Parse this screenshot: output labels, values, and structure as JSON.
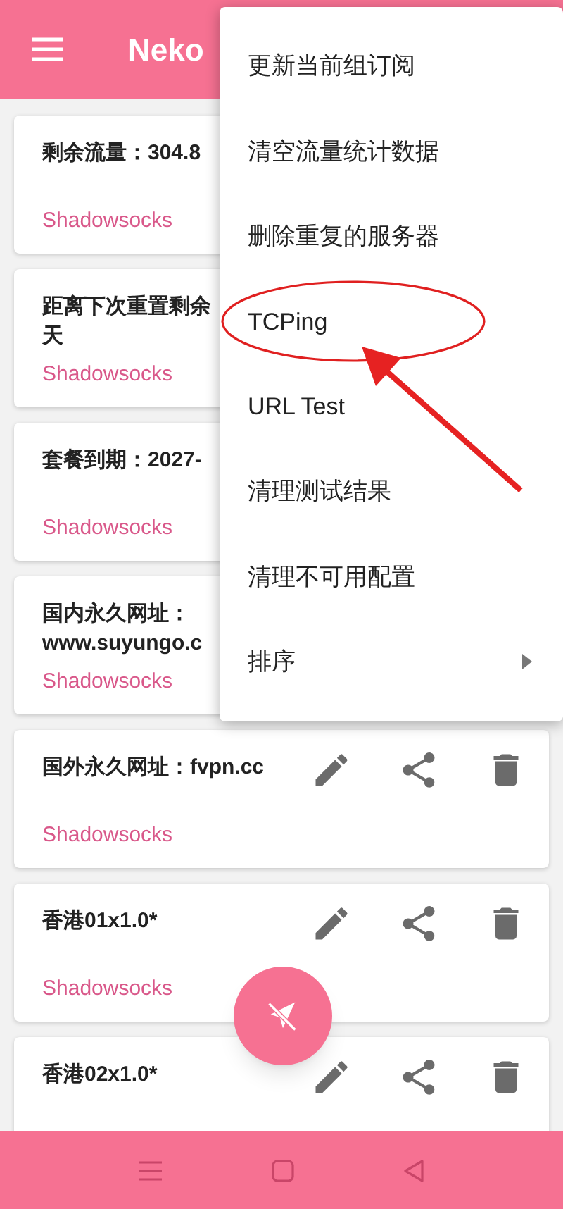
{
  "app_bar": {
    "title": "Neko"
  },
  "cards": [
    {
      "lines": [
        "剩余流量：304.8"
      ],
      "protocol": "Shadowsocks"
    },
    {
      "lines": [
        "距离下次重置剩余",
        "天"
      ],
      "protocol": "Shadowsocks"
    },
    {
      "lines": [
        "套餐到期：2027-"
      ],
      "protocol": "Shadowsocks"
    },
    {
      "lines": [
        "国内永久网址：",
        "www.suyungo.c"
      ],
      "protocol": "Shadowsocks"
    },
    {
      "lines": [
        "国外永久网址：fvpn.cc"
      ],
      "protocol": "Shadowsocks",
      "actions_visible": true
    },
    {
      "lines": [
        "香港01x1.0*"
      ],
      "protocol": "Shadowsocks",
      "actions_visible": true
    },
    {
      "lines": [
        "香港02x1.0*"
      ],
      "actions_visible": true
    }
  ],
  "menu": [
    {
      "label": "更新当前组订阅",
      "kind": "item",
      "annotated": false
    },
    {
      "label": "清空流量统计数据",
      "kind": "item",
      "annotated": false
    },
    {
      "label": "删除重复的服务器",
      "kind": "item",
      "annotated": false
    },
    {
      "label": "TCPing",
      "kind": "item",
      "annotated": true
    },
    {
      "label": "URL Test",
      "kind": "item",
      "annotated": false
    },
    {
      "label": "清理测试结果",
      "kind": "item",
      "annotated": false
    },
    {
      "label": "清理不可用配置",
      "kind": "item",
      "annotated": false
    },
    {
      "label": "排序",
      "kind": "submenu",
      "annotated": false
    }
  ]
}
